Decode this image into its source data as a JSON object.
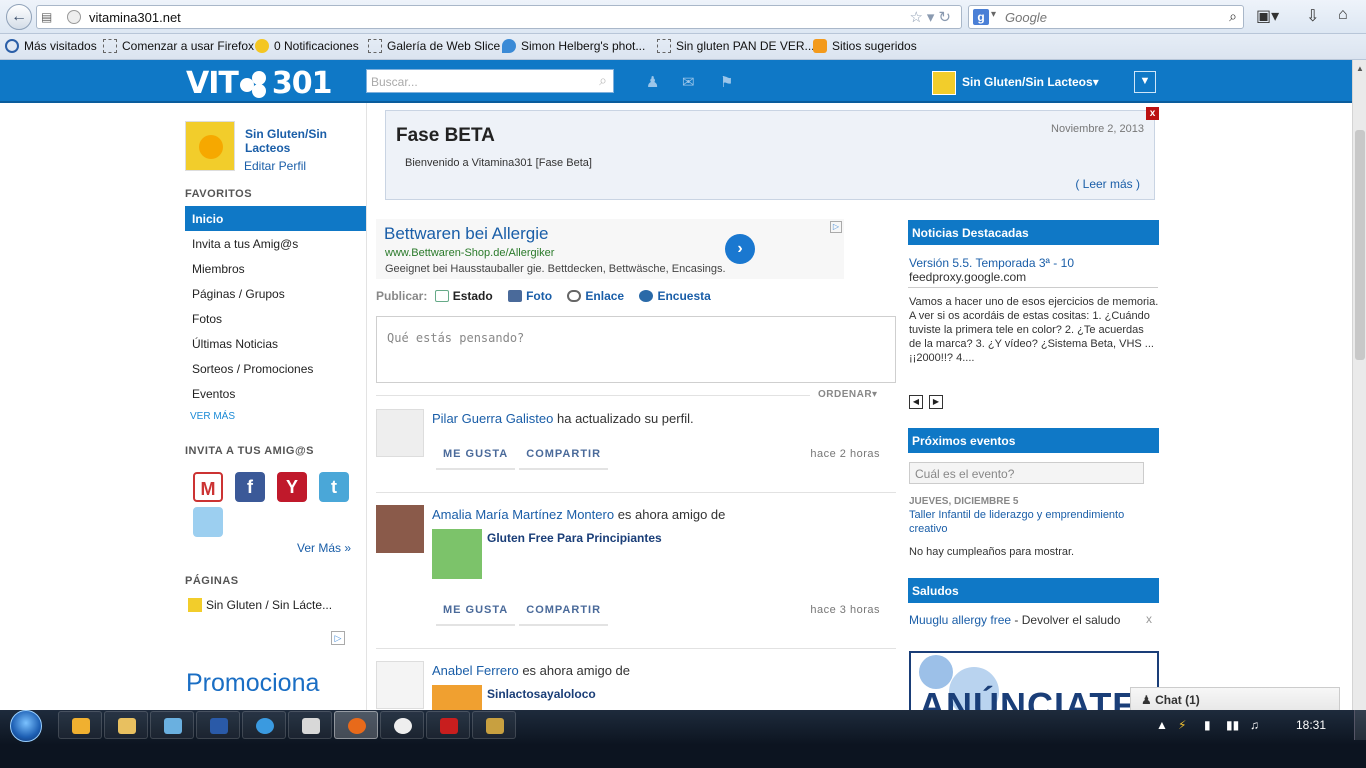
{
  "browser": {
    "url": "vitamina301.net",
    "search_placeholder": "Google",
    "search_engine_letter": "g"
  },
  "bookmarks": [
    {
      "label": "Más visitados"
    },
    {
      "label": "Comenzar a usar Firefox"
    },
    {
      "label": "0 Notificaciones"
    },
    {
      "label": "Galería de Web Slice"
    },
    {
      "label": "Simon Helberg's phot..."
    },
    {
      "label": "Sin gluten PAN DE VER..."
    },
    {
      "label": "Sitios sugeridos"
    }
  ],
  "header": {
    "logo_left": "VIT",
    "logo_right": "301",
    "search_placeholder": "Buscar...",
    "user_menu": "Sin Gluten/Sin Lacteos▾",
    "brand_color": "#0f78c6"
  },
  "sidebar": {
    "profile_name": "Sin Gluten/Sin Lacteos",
    "edit_profile": "Editar Perfil",
    "favorites_title": "FAVORITOS",
    "items": [
      {
        "label": "Inicio",
        "active": true
      },
      {
        "label": "Invita a tus Amig@s"
      },
      {
        "label": "Miembros"
      },
      {
        "label": "Páginas / Grupos"
      },
      {
        "label": "Fotos"
      },
      {
        "label": "Últimas Noticias"
      },
      {
        "label": "Sorteos / Promociones"
      },
      {
        "label": "Eventos"
      }
    ],
    "ver_mas": "VER MÁS",
    "invite_title": "INVITA A TUS AMIG@S",
    "ver_mas_link": "Ver Más »",
    "pages_title": "PÁGINAS",
    "page_item": "Sin Gluten / Sin Lácte...",
    "promo_text": "Promociona"
  },
  "beta": {
    "title": "Fase BETA",
    "date": "Noviembre 2, 2013",
    "message": "Bienvenido a Vitamina301 [Fase Beta]",
    "more": "( Leer más )",
    "close": "x"
  },
  "ad": {
    "title": "Bettwaren bei Allergie",
    "url": "www.Bettwaren-Shop.de/Allergiker",
    "desc": "Geeignet bei Hausstauballer gie. Bettdecken, Bettwäsche, Encasings."
  },
  "publish": {
    "label": "Publicar:",
    "tabs": [
      "Estado",
      "Foto",
      "Enlace",
      "Encuesta"
    ],
    "placeholder": "Qué estás pensando?",
    "order": "ORDENAR▾"
  },
  "feed": [
    {
      "actor": "Pilar Guerra Galisteo",
      "action": " ha actualizado su perfil.",
      "like": "ME GUSTA",
      "share": "COMPARTIR",
      "time": "hace 2 horas"
    },
    {
      "actor": "Amalia María Martínez Montero",
      "action": " es ahora amigo de",
      "object": "Gluten Free Para Principiantes",
      "like": "ME GUSTA",
      "share": "COMPARTIR",
      "time": "hace 3 horas"
    },
    {
      "actor": "Anabel Ferrero",
      "action": " es ahora amigo de",
      "object": "Sinlactosayaloloco"
    }
  ],
  "right": {
    "news_title": "Noticias Destacadas",
    "news_link": "Versión 5.5. Temporada 3ª - 10",
    "news_source": "feedproxy.google.com",
    "news_body": "Vamos a hacer uno de esos ejercicios de memoria. A ver si os acordáis de estas cositas: 1. ¿Cuándo tuviste la primera tele en color? 2. ¿Te acuerdas de la marca? 3. ¿Y vídeo? ¿Sistema Beta, VHS ... ¡¡2000!!? 4....",
    "events_title": "Próximos eventos",
    "event_placeholder": "Cuál es el evento?",
    "event_date": "JUEVES, DICIEMBRE 5",
    "event_name": "Taller Infantil de liderazgo y emprendimiento creativo",
    "no_birthdays": "No hay cumpleaños para mostrar.",
    "greetings_title": "Saludos",
    "greet_name": "Muuglu allergy free",
    "greet_action": " - Devolver el saludo",
    "greet_close": "x",
    "announce": "ANÚNCIATE"
  },
  "chat": {
    "label": "Chat (1)"
  },
  "taskbar": {
    "time": "18:31"
  }
}
